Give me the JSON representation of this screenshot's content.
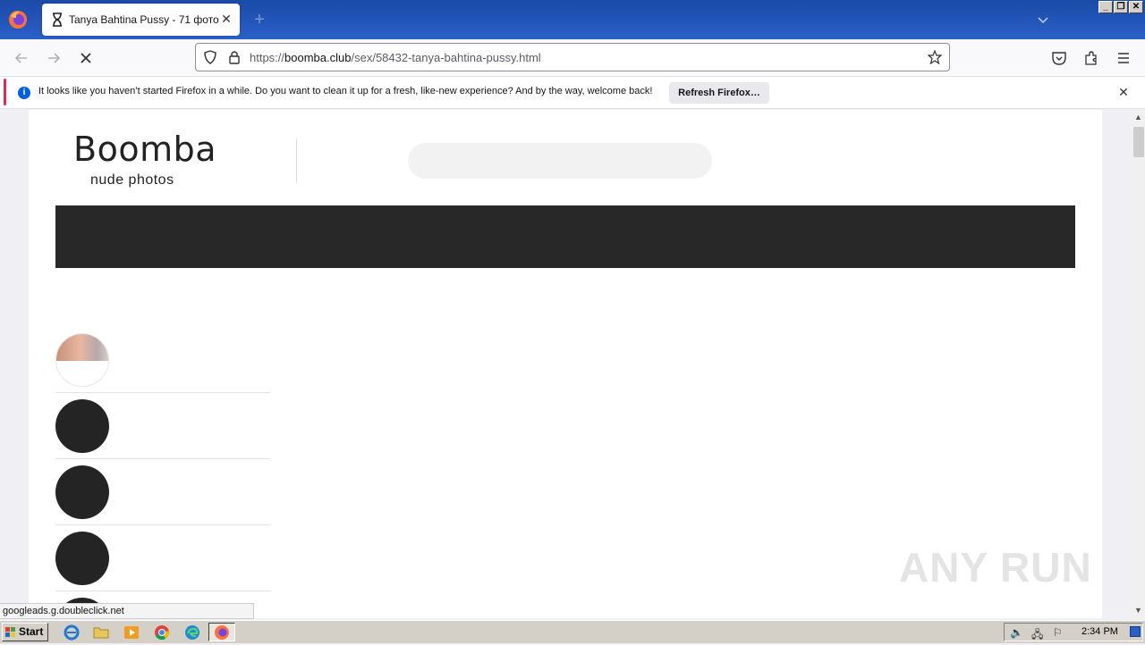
{
  "browser": {
    "tab": {
      "title": "Tanya Bahtina Pussy - 71 фото"
    },
    "url": {
      "scheme": "https://",
      "domain": "boomba.club",
      "path": "/sex/58432-tanya-bahtina-pussy.html"
    },
    "notification": {
      "message": "It looks like you haven’t started Firefox in a while. Do you want to clean it up for a fresh, like-new experience? And by the way, welcome back!",
      "button_label": "Refresh Firefox…"
    },
    "status_text": "googleads.g.doubleclick.net"
  },
  "site": {
    "logo_main": "Boomba",
    "logo_sub": "nude photos",
    "watermark": "ANY RUN"
  },
  "taskbar": {
    "start_label": "Start",
    "clock": "2:34 PM"
  },
  "colors": {
    "titlebar": "#1a4ba8",
    "notification_accent": "#e22850",
    "nav_band": "#282828"
  }
}
